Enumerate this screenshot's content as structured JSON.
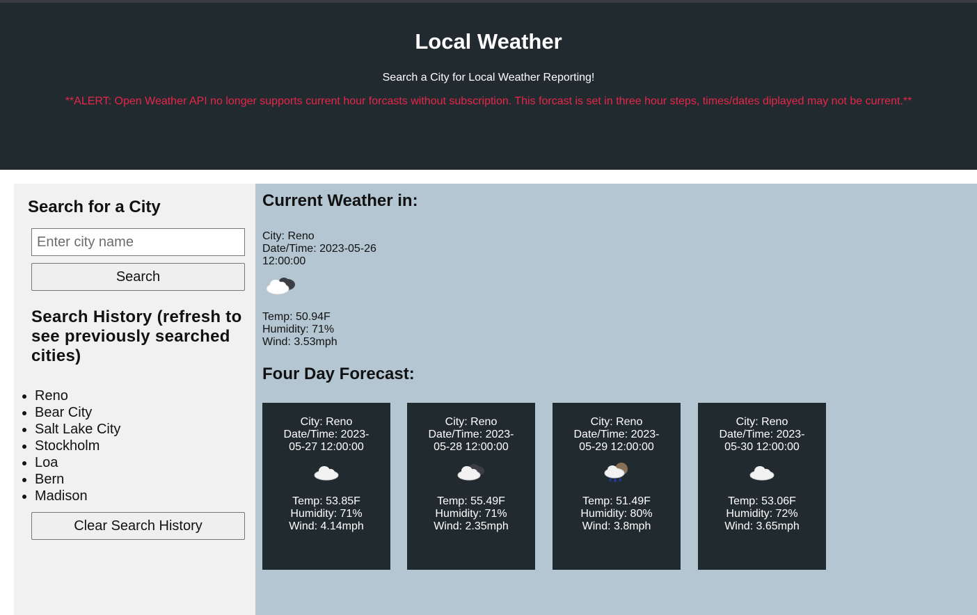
{
  "header": {
    "title": "Local Weather",
    "subtitle": "Search a City for Local Weather Reporting!",
    "alert": "**ALERT: Open Weather API no longer supports current hour forcasts without subscription. This forcast is set in three hour steps, times/dates diplayed may not be current.**"
  },
  "sidebar": {
    "title": "Search for a City",
    "input_placeholder": "Enter city name",
    "search_label": "Search",
    "history_title": "Search History (refresh to see previously searched cities)",
    "history": [
      "Reno",
      "Bear City",
      "Salt Lake City",
      "Stockholm",
      "Loa",
      "Bern",
      "Madison"
    ],
    "clear_label": "Clear Search History"
  },
  "current": {
    "heading": "Current Weather in:",
    "city": "City: Reno",
    "datetime": "Date/Time: 2023-05-26 12:00:00",
    "icon": "partly-cloudy-icon",
    "temp": "Temp: 50.94F",
    "humidity": "Humidity: 71%",
    "wind": "Wind: 3.53mph"
  },
  "forecast": {
    "heading": "Four Day Forecast:",
    "days": [
      {
        "city": "City: Reno",
        "datetime": "Date/Time: 2023-05-27 12:00:00",
        "icon": "cloud-icon",
        "temp": "Temp: 53.85F",
        "humidity": "Humidity: 71%",
        "wind": "Wind: 4.14mph"
      },
      {
        "city": "City: Reno",
        "datetime": "Date/Time: 2023-05-28 12:00:00",
        "icon": "partly-cloudy-icon",
        "temp": "Temp: 55.49F",
        "humidity": "Humidity: 71%",
        "wind": "Wind: 2.35mph"
      },
      {
        "city": "City: Reno",
        "datetime": "Date/Time: 2023-05-29 12:00:00",
        "icon": "rain-sun-icon",
        "temp": "Temp: 51.49F",
        "humidity": "Humidity: 80%",
        "wind": "Wind: 3.8mph"
      },
      {
        "city": "City: Reno",
        "datetime": "Date/Time: 2023-05-30 12:00:00",
        "icon": "cloud-icon",
        "temp": "Temp: 53.06F",
        "humidity": "Humidity: 72%",
        "wind": "Wind: 3.65mph"
      }
    ]
  },
  "colors": {
    "header_bg": "#212a2e",
    "alert": "#e8254b",
    "main_bg": "#b4c6d2",
    "sidebar_bg": "#f1f1f1"
  }
}
